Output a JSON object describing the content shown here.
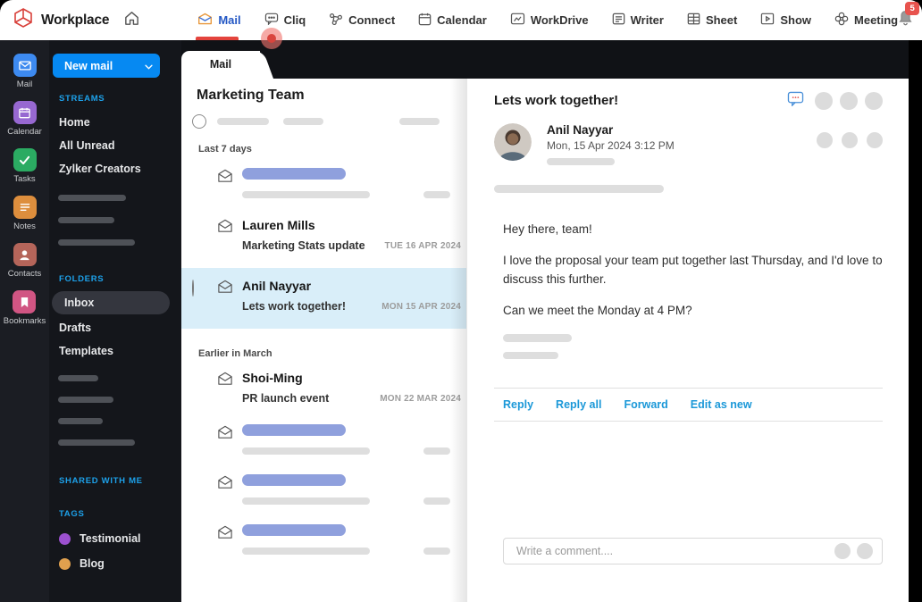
{
  "colors": {
    "accent_blue": "#0689f2",
    "link_blue": "#1b98d8",
    "section_label_blue": "#1da1ea",
    "brand_red": "#e0403a",
    "active_nav_blue": "#2357c4",
    "nav_underline_red": "#e4443d",
    "selected_mail_bg": "#d9eef9",
    "skeleton_blue": "#8fa0dd",
    "skeleton_gray": "#dedede",
    "badge_red": "#e8534e"
  },
  "topbar": {
    "brand": "Workplace",
    "notification_count": "5",
    "nav": [
      {
        "label": "Mail",
        "icon": "mail-icon",
        "active": true
      },
      {
        "label": "Cliq",
        "icon": "cliq-icon",
        "active": false
      },
      {
        "label": "Connect",
        "icon": "connect-icon",
        "active": false
      },
      {
        "label": "Calendar",
        "icon": "calendar-icon",
        "active": false
      },
      {
        "label": "WorkDrive",
        "icon": "workdrive-icon",
        "active": false
      },
      {
        "label": "Writer",
        "icon": "writer-icon",
        "active": false
      },
      {
        "label": "Sheet",
        "icon": "sheet-icon",
        "active": false
      },
      {
        "label": "Show",
        "icon": "show-icon",
        "active": false
      },
      {
        "label": "Meeting",
        "icon": "meeting-icon",
        "active": false
      }
    ]
  },
  "rail": {
    "items": [
      {
        "label": "Mail",
        "icon": "mail-icon",
        "color": "#3d8af0"
      },
      {
        "label": "Calendar",
        "icon": "calendar-icon",
        "color": "#9768d1"
      },
      {
        "label": "Tasks",
        "icon": "tasks-icon",
        "color": "#2bab62"
      },
      {
        "label": "Notes",
        "icon": "notes-icon",
        "color": "#dd8e3d"
      },
      {
        "label": "Contacts",
        "icon": "contacts-icon",
        "color": "#b5655a"
      },
      {
        "label": "Bookmarks",
        "icon": "bookmarks-icon",
        "color": "#d15583"
      }
    ]
  },
  "sidebar": {
    "new_mail_label": "New mail",
    "streams_label": "STREAMS",
    "streams": [
      "Home",
      "All Unread",
      "Zylker Creators"
    ],
    "folders_label": "FOLDERS",
    "folders": [
      "Inbox",
      "Drafts",
      "Templates"
    ],
    "active_folder": "Inbox",
    "shared_label": "SHARED WITH ME",
    "tags_label": "TAGS",
    "tags": [
      {
        "label": "Testimonial",
        "color": "#9c50cf"
      },
      {
        "label": "Blog",
        "color": "#e0a04e"
      }
    ]
  },
  "mail_list": {
    "tab_label": "Mail",
    "title": "Marketing Team",
    "groups": [
      {
        "label": "Last 7 days"
      },
      {
        "label": "Earlier in March"
      }
    ],
    "items": [
      {
        "sender": "Lauren Mills",
        "subject": "Marketing Stats update",
        "date": "TUE 16 APR 2024"
      },
      {
        "sender": "Anil Nayyar",
        "subject": "Lets work together!",
        "date": "MON 15 APR 2024",
        "selected": true
      },
      {
        "sender": "Shoi-Ming",
        "subject": "PR launch event",
        "date": "MON 22 MAR 2024"
      }
    ]
  },
  "reading": {
    "title": "Lets work together!",
    "sender": "Anil Nayyar",
    "datetime": "Mon, 15 Apr 2024  3:12 PM",
    "body": [
      "Hey there, team!",
      "I love the proposal your team put together last Thursday, and I'd love to discuss this further.",
      "Can we meet the Monday at 4 PM?"
    ],
    "actions": [
      "Reply",
      "Reply all",
      "Forward",
      "Edit as new"
    ],
    "comment_placeholder": "Write a comment...."
  }
}
